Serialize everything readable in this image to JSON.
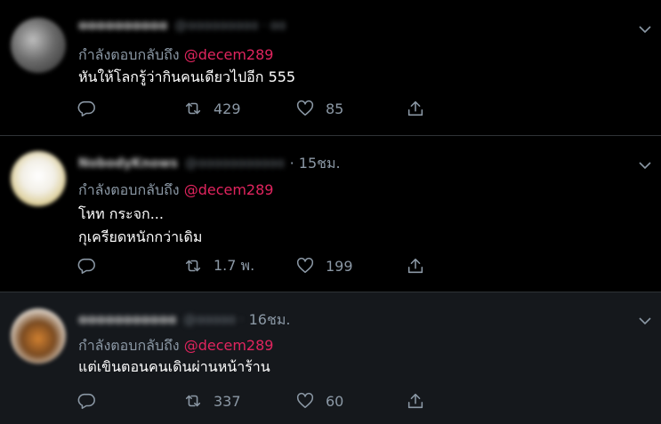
{
  "colors": {
    "background": "#000000",
    "selected_background": "#15181c",
    "mention": "#e0245e",
    "muted": "#8b98a5",
    "text": "#ffffff",
    "divider": "#2f3336"
  },
  "tweets": [
    {
      "display_name": "ɑɑɑɑɑɑɑɑɑɑ",
      "handle": "@ɑɑɑɑɑɑɑɑɑ · ɑɑ",
      "time": "",
      "reply_prefix": "กำลังตอบกลับถึง ",
      "mention": "@decem289",
      "lines": [
        "หันให้โลกรู้ว่ากินคนเดียวไปอีก 555"
      ],
      "reply_count": "",
      "retweets": "429",
      "likes": "85"
    },
    {
      "display_name": "NobodyKnows",
      "handle": "@ɑɑɑɑɑɑɑɑɑɑɑ",
      "time": "· 15ชม.",
      "reply_prefix": "กำลังตอบกลับถึง ",
      "mention": "@decem289",
      "lines": [
        "โหท กระจก...",
        "กุเครียดหนักกว่าเดิม"
      ],
      "reply_count": "",
      "retweets": "1.7 พ.",
      "likes": "199"
    },
    {
      "display_name": "ɑɑɑɑɑɑɑɑɑɑɑ",
      "handle": "@ɑɑɑɑɑ ·",
      "time": "16ชม.",
      "reply_prefix": "กำลังตอบกลับถึง ",
      "mention": "@decem289",
      "lines": [
        "แต่เขินตอนคนเดินผ่านหน้าร้าน"
      ],
      "reply_count": "",
      "retweets": "337",
      "likes": "60"
    }
  ],
  "icons": {
    "reply": "reply-icon",
    "retweet": "retweet-icon",
    "like": "heart-icon",
    "share": "share-icon",
    "more": "chevron-down-icon"
  }
}
